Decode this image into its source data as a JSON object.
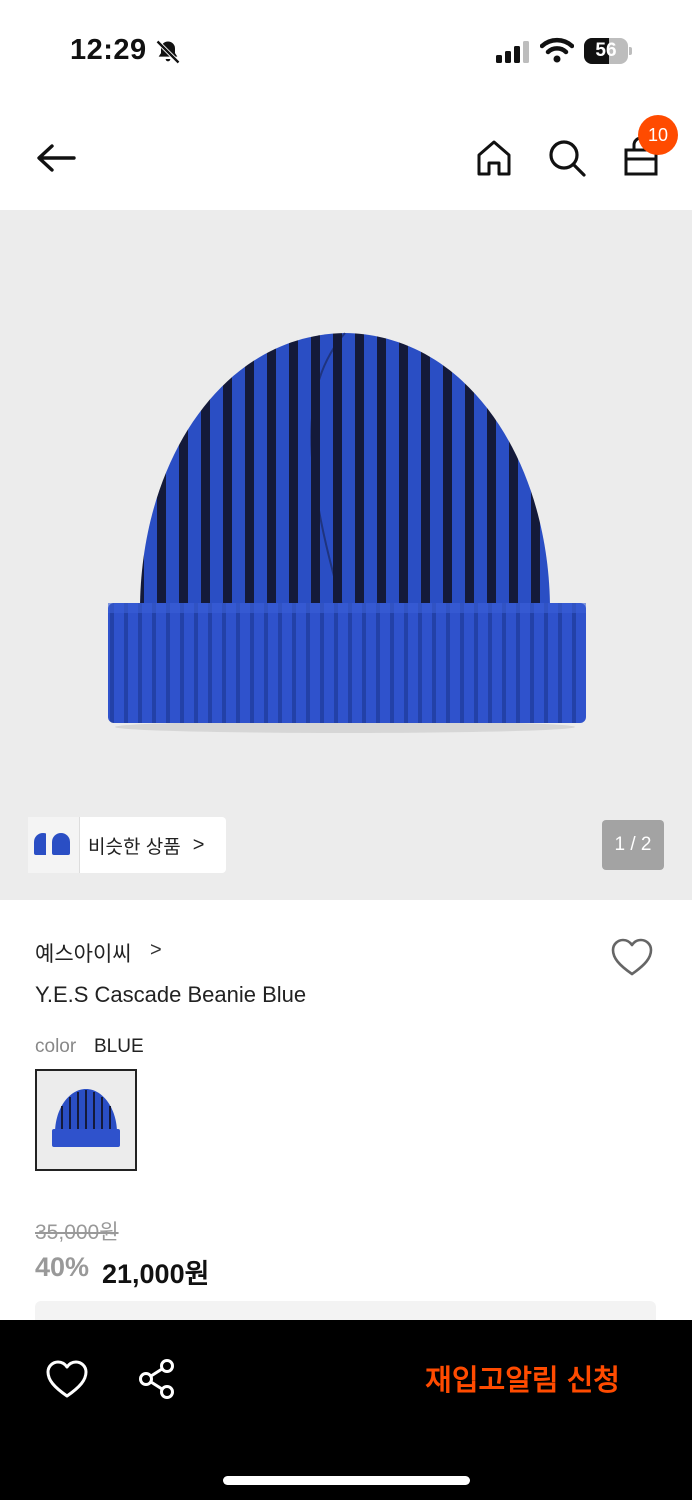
{
  "status_bar": {
    "time": "12:29",
    "battery": "56",
    "battery_level": 0.56
  },
  "nav": {
    "icons": [
      "back-arrow-icon",
      "home-icon",
      "search-icon",
      "shopping-bag-icon"
    ],
    "cart_count": "10"
  },
  "gallery": {
    "similar_label": "비슷한 상품",
    "similar_chevron": ">",
    "counter": "1 / 2"
  },
  "product": {
    "brand": "예스아이씨",
    "brand_chevron": ">",
    "name": "Y.E.S Cascade Beanie Blue",
    "color_label": "color",
    "color_value": "BLUE",
    "original_price": "35,000원",
    "discount": "40%",
    "sale_price": "21,000원"
  },
  "bottom_bar": {
    "restock_label": "재입고알림 신청",
    "icons": [
      "heart-icon",
      "share-icon"
    ]
  },
  "colors": {
    "accent": "#ff4b00",
    "beanie_blue": "#2a4ec4",
    "beanie_navy": "#141a3a"
  }
}
